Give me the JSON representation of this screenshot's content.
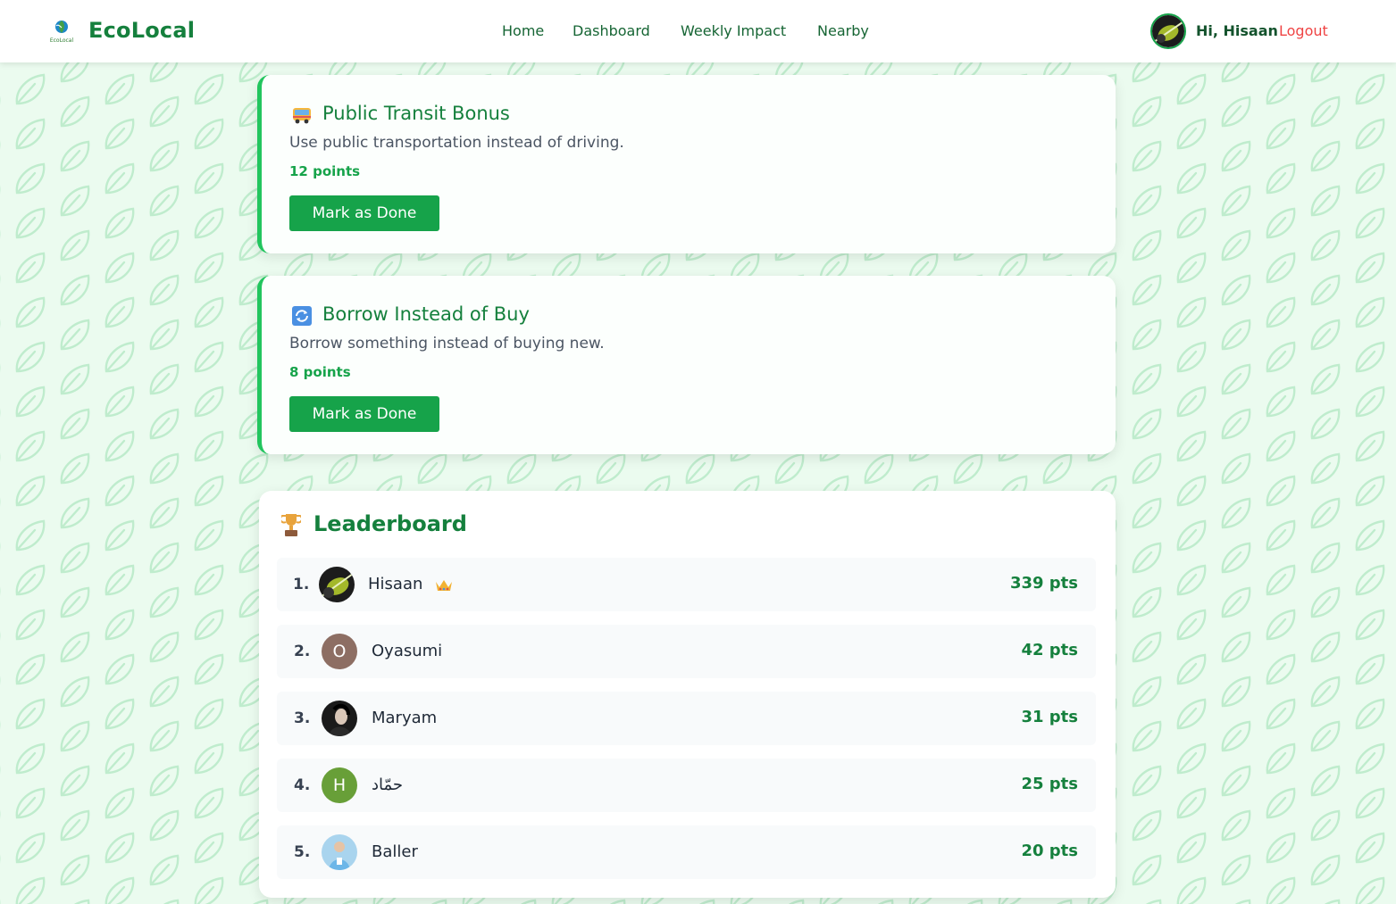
{
  "brand": {
    "name": "EcoLocal",
    "logo_text": "EcoLocal"
  },
  "nav": {
    "home": "Home",
    "dashboard": "Dashboard",
    "weekly_impact": "Weekly Impact",
    "nearby": "Nearby"
  },
  "user": {
    "greeting": "Hi, Hisaan",
    "logout": "Logout"
  },
  "challenges": [
    {
      "title": "Public Transit Bonus",
      "description": "Use public transportation instead of driving.",
      "points": "12 points",
      "button": "Mark as Done",
      "icon": "bus-icon"
    },
    {
      "title": "Borrow Instead of Buy",
      "description": "Borrow something instead of buying new.",
      "points": "8 points",
      "button": "Mark as Done",
      "icon": "repeat-icon"
    }
  ],
  "leaderboard": {
    "title": "Leaderboard",
    "icon": "trophy-icon",
    "entries": [
      {
        "rank": "1.",
        "name": "Hisaan",
        "points": "339 pts",
        "badge": "crown-icon"
      },
      {
        "rank": "2.",
        "name": "Oyasumi",
        "points": "42 pts",
        "initial": "O",
        "avatar_color": "#8d6e63"
      },
      {
        "rank": "3.",
        "name": "Maryam",
        "points": "31 pts"
      },
      {
        "rank": "4.",
        "name": "حمّاد",
        "points": "25 pts",
        "initial": "H",
        "avatar_color": "#689f38"
      },
      {
        "rank": "5.",
        "name": "Baller",
        "points": "20 pts"
      }
    ]
  },
  "colors": {
    "primary_green": "#16a34a",
    "heading_green": "#15803d",
    "logout_red": "#ef4444",
    "background": "#ebfbef"
  }
}
